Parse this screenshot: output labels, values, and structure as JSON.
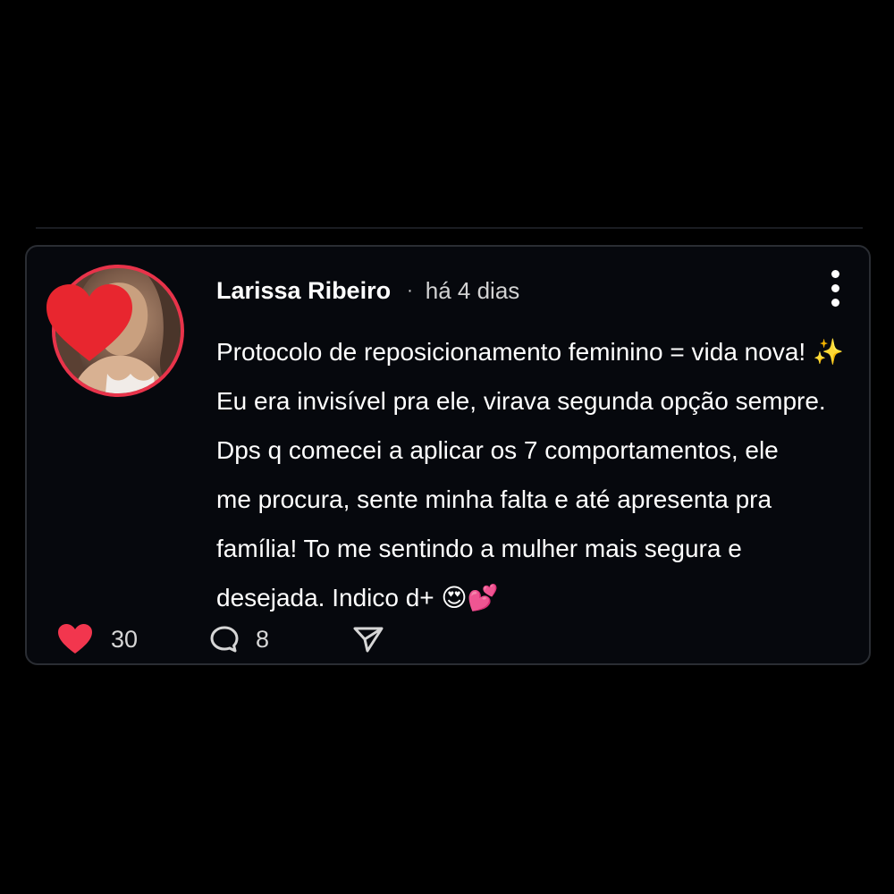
{
  "post": {
    "author": "Larissa Ribeiro",
    "separator": "·",
    "time": "há 4 dias",
    "lines": [
      "Protocolo de reposicionamento feminino = vida nova! ✨",
      "Eu era invisível pra ele, virava segunda opção sempre.",
      "Dps q comecei a aplicar os 7 comportamentos, ele",
      "me procura, sente minha falta e até apresenta pra",
      "família! To me sentindo a mulher mais segura e",
      "desejada. Indico d+ 😍💕"
    ]
  },
  "actions": {
    "likes": "30",
    "comments": "8"
  },
  "icons": {
    "avatar_sticker": "red-heart-icon",
    "like": "heart-icon",
    "comment": "comment-bubble-icon",
    "share": "paper-plane-icon",
    "more": "vertical-dots-icon"
  },
  "colors": {
    "background": "#000000",
    "card": "#06080d",
    "accent": "#e8334a",
    "text": "#ffffff"
  }
}
